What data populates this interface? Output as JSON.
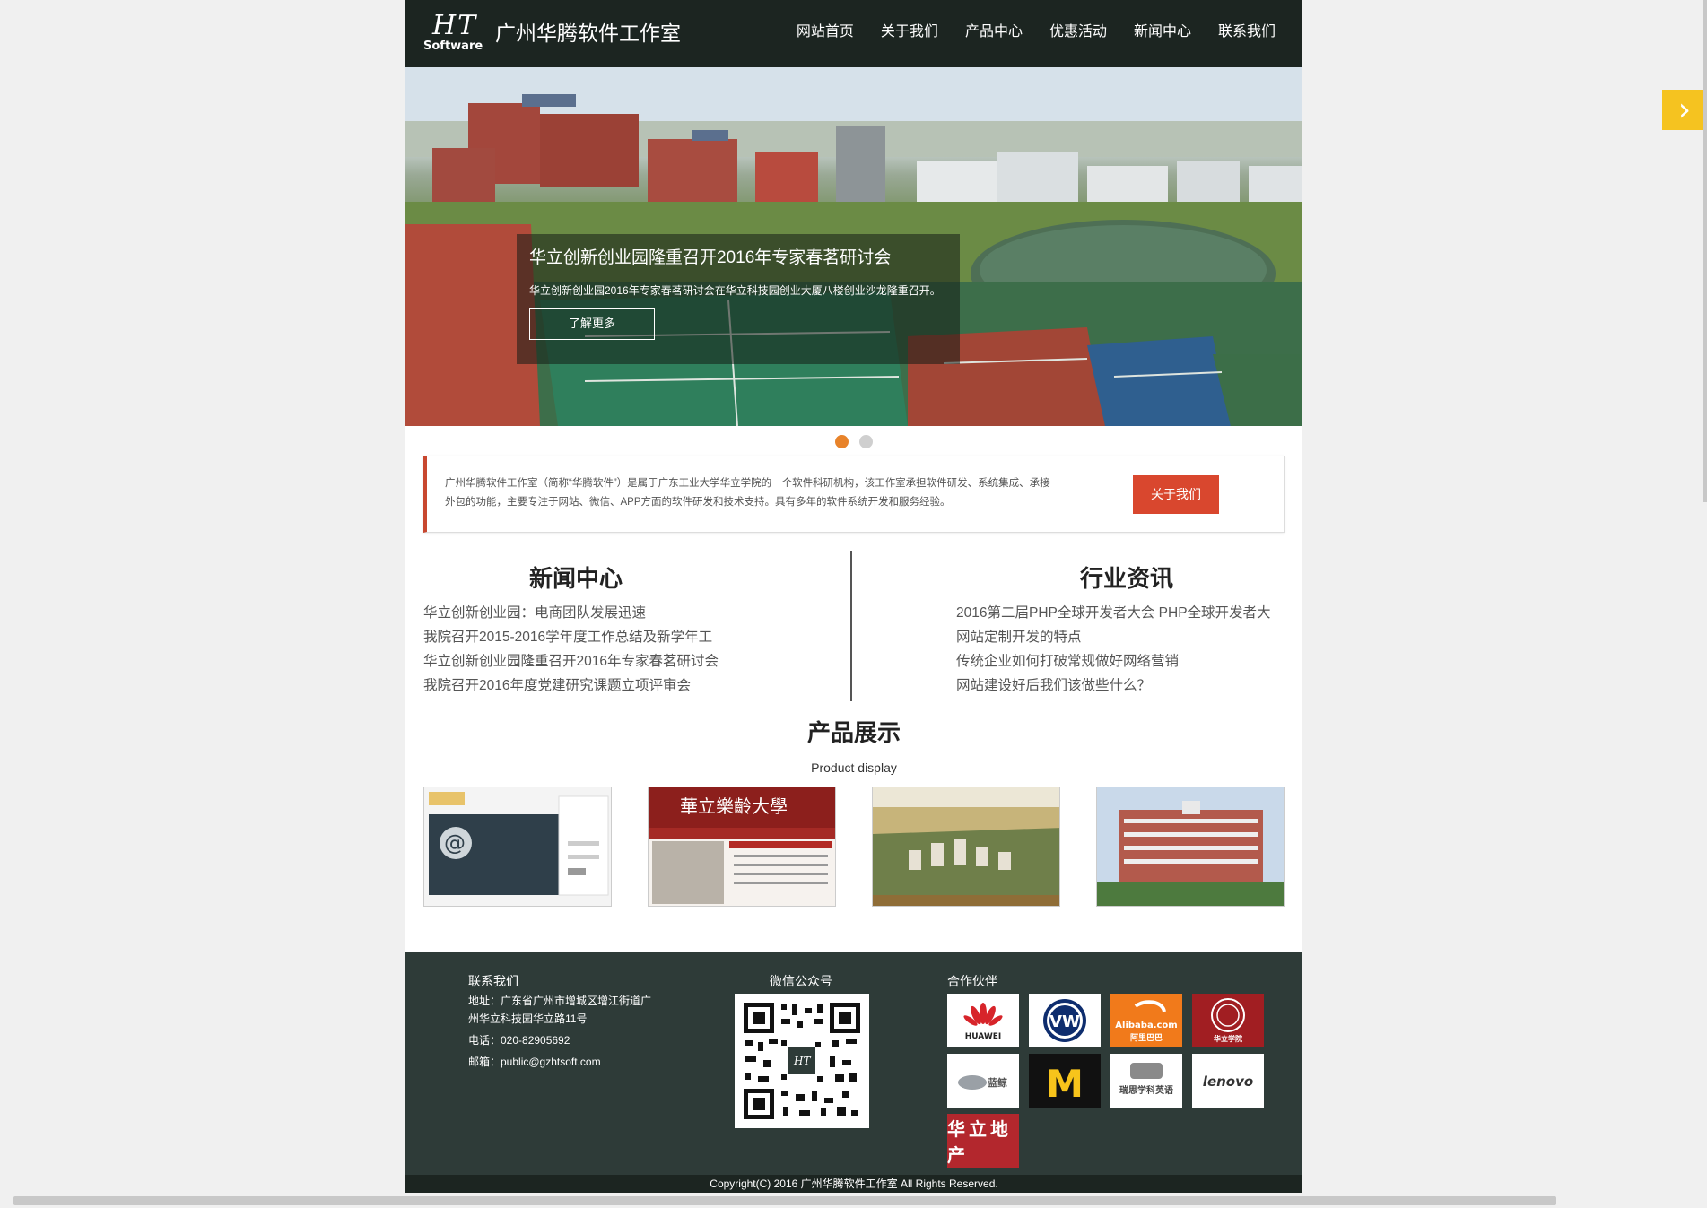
{
  "header": {
    "logo_ht": "HT",
    "logo_sub": "Software",
    "site_title": "广州华腾软件工作室",
    "nav": [
      "网站首页",
      "关于我们",
      "产品中心",
      "优惠活动",
      "新闻中心",
      "联系我们"
    ]
  },
  "banner": {
    "caption_title": "华立创新创业园隆重召开2016年专家春茗研讨会",
    "caption_text": "华立创新创业园2016年专家春茗研讨会在华立科技园创业大厦八楼创业沙龙隆重召开。",
    "button_label": "了解更多",
    "slide_count": 2,
    "active_slide": 1
  },
  "intro": {
    "text": "广州华腾软件工作室（简称“华腾软件”）是属于广东工业大学华立学院的一个软件科研机构，该工作室承担软件研发、系统集成、承接外包的功能，主要专注于网站、微信、APP方面的软件研发和技术支持。具有多年的软件系统开发和服务经验。",
    "button_label": "关于我们"
  },
  "news": {
    "title": "新闻中心",
    "items": [
      "华立创新创业园：电商团队发展迅速",
      "我院召开2015-2016学年度工作总结及新学年工",
      "华立创新创业园隆重召开2016年专家春茗研讨会",
      "我院召开2016年度党建研究课题立项评审会"
    ]
  },
  "industry": {
    "title": "行业资讯",
    "items": [
      "2016第二届PHP全球开发者大会 PHP全球开发者大",
      "网站定制开发的特点",
      "传统企业如何打破常规做好网络营销",
      "网站建设好后我们该做些什么？"
    ]
  },
  "products": {
    "title": "产品展示",
    "subtitle": "Product display",
    "p2_banner_text": "華立樂齡大學"
  },
  "footer": {
    "contact_title": "联系我们",
    "address_line1": "地址：广东省广州市增城区增江街道广",
    "address_line2": "州华立科技园华立路11号",
    "phone": "电话：020-82905692",
    "email": "邮箱：public@gzhtsoft.com",
    "wechat_title": "微信公众号",
    "partners_title": "合作伙伴",
    "partners": [
      "HUAWEI",
      "VW",
      "Alibaba.com",
      "华立学院",
      "蓝鲸",
      "M",
      "瑞思学科英语",
      "lenovo",
      "华立地产"
    ],
    "partner_sub_alibaba": "阿里巴巴",
    "copyright": "Copyright(C) 2016 广州华腾软件工作室 All Rights Reserved."
  },
  "colors": {
    "header_bg": "#1c2521",
    "footer_bg": "#2e3b38",
    "accent": "#d9472e",
    "dot_active": "#e8832a",
    "side_arrow": "#f5c320"
  }
}
